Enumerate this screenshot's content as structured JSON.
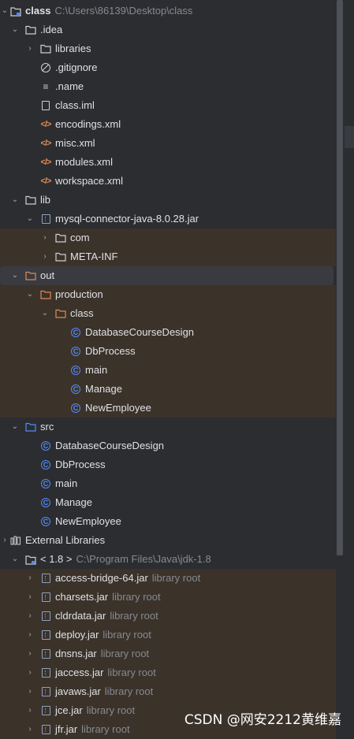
{
  "tree": [
    {
      "label": "class",
      "sub": "C:\\Users\\86139\\Desktop\\class",
      "bold": true,
      "chev": "down",
      "icon": "module-folder-icon"
    },
    {
      "label": ".idea",
      "chev": "down",
      "icon": "folder-icon"
    },
    {
      "label": "libraries",
      "chev": "right",
      "icon": "folder-icon"
    },
    {
      "label": ".gitignore",
      "icon": "ignore-file-icon"
    },
    {
      "label": ".name",
      "icon": "text-file-icon"
    },
    {
      "label": "class.iml",
      "icon": "iml-file-icon"
    },
    {
      "label": "encodings.xml",
      "icon": "xml-file-icon"
    },
    {
      "label": "misc.xml",
      "icon": "xml-file-icon"
    },
    {
      "label": "modules.xml",
      "icon": "xml-file-icon"
    },
    {
      "label": "workspace.xml",
      "icon": "xml-file-icon"
    },
    {
      "label": "lib",
      "chev": "down",
      "icon": "folder-icon"
    },
    {
      "label": "mysql-connector-java-8.0.28.jar",
      "chev": "down",
      "icon": "jar-icon"
    },
    {
      "label": "com",
      "chev": "right",
      "icon": "folder-icon"
    },
    {
      "label": "META-INF",
      "chev": "right",
      "icon": "folder-icon"
    },
    {
      "label": "out",
      "chev": "down",
      "icon": "excluded-folder-icon"
    },
    {
      "label": "production",
      "chev": "down",
      "icon": "excluded-folder-icon"
    },
    {
      "label": "class",
      "chev": "down",
      "icon": "excluded-folder-icon"
    },
    {
      "label": "DatabaseCourseDesign",
      "icon": "class-icon"
    },
    {
      "label": "DbProcess",
      "icon": "class-icon"
    },
    {
      "label": "main",
      "icon": "class-icon"
    },
    {
      "label": "Manage",
      "icon": "class-icon"
    },
    {
      "label": "NewEmployee",
      "icon": "class-icon"
    },
    {
      "label": "src",
      "chev": "down",
      "icon": "source-folder-icon"
    },
    {
      "label": "DatabaseCourseDesign",
      "icon": "class-icon"
    },
    {
      "label": "DbProcess",
      "icon": "class-icon"
    },
    {
      "label": "main",
      "icon": "class-icon"
    },
    {
      "label": "Manage",
      "icon": "class-icon"
    },
    {
      "label": "NewEmployee",
      "icon": "class-icon"
    },
    {
      "label": "External Libraries",
      "chev": "right",
      "icon": "library-icon"
    },
    {
      "label": "< 1.8 >",
      "sub": "C:\\Program Files\\Java\\jdk-1.8",
      "chev": "down",
      "icon": "sdk-folder-icon"
    },
    {
      "label": "access-bridge-64.jar",
      "sub": "library root",
      "chev": "right",
      "icon": "jar-icon"
    },
    {
      "label": "charsets.jar",
      "sub": "library root",
      "chev": "right",
      "icon": "jar-icon"
    },
    {
      "label": "cldrdata.jar",
      "sub": "library root",
      "chev": "right",
      "icon": "jar-icon"
    },
    {
      "label": "deploy.jar",
      "sub": "library root",
      "chev": "right",
      "icon": "jar-icon"
    },
    {
      "label": "dnsns.jar",
      "sub": "library root",
      "chev": "right",
      "icon": "jar-icon"
    },
    {
      "label": "jaccess.jar",
      "sub": "library root",
      "chev": "right",
      "icon": "jar-icon"
    },
    {
      "label": "javaws.jar",
      "sub": "library root",
      "chev": "right",
      "icon": "jar-icon"
    },
    {
      "label": "jce.jar",
      "sub": "library root",
      "chev": "right",
      "icon": "jar-icon"
    },
    {
      "label": "jfr.jar",
      "sub": "library root",
      "chev": "right",
      "icon": "jar-icon"
    }
  ],
  "watermark": "CSDN @网安2212黄维嘉"
}
